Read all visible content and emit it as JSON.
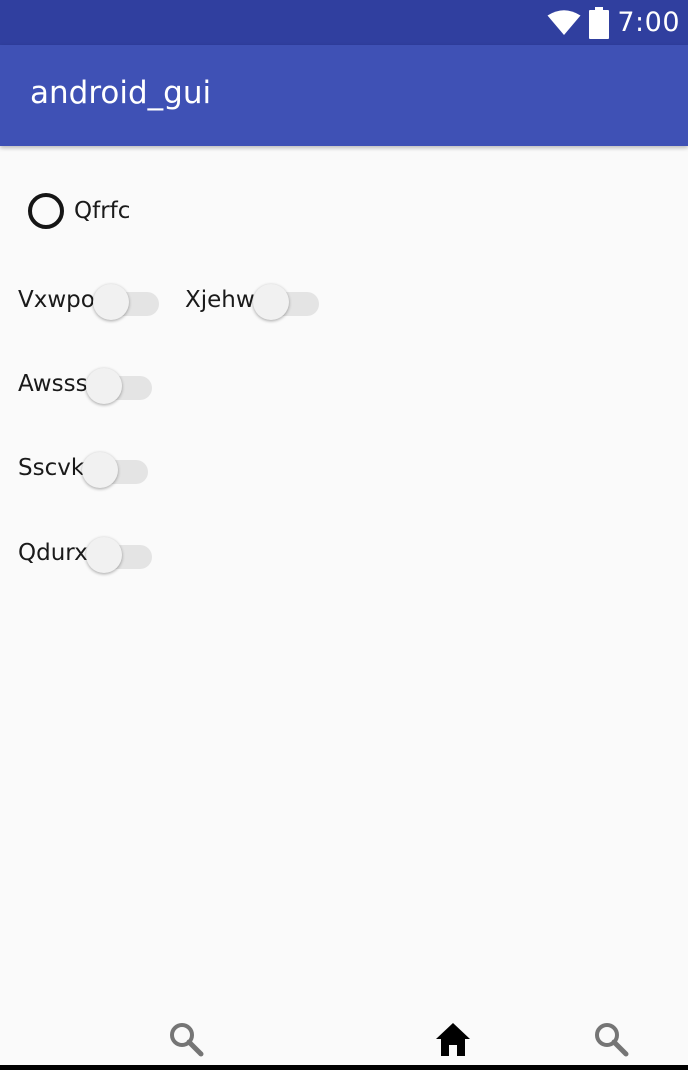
{
  "status_bar": {
    "time": "7:00",
    "icons": [
      "wifi-icon",
      "battery-icon"
    ],
    "background": "#303F9F"
  },
  "app_bar": {
    "title": "android_gui",
    "background": "#3F51B5"
  },
  "radio": {
    "label": "Qfrfc",
    "checked": false
  },
  "switches": [
    {
      "label": "Vxwpo",
      "on": false
    },
    {
      "label": "Xjehw",
      "on": false
    },
    {
      "label": "Awsss",
      "on": false
    },
    {
      "label": "Sscvk",
      "on": false
    },
    {
      "label": "Qdurx",
      "on": false
    }
  ],
  "bottom_nav": {
    "items": [
      "search-icon",
      "home-icon",
      "search-icon"
    ]
  }
}
